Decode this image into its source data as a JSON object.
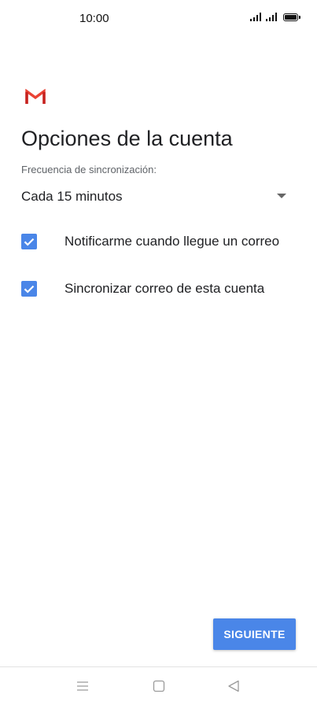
{
  "status_bar": {
    "time": "10:00"
  },
  "app": {
    "logo_icon": "gmail-logo-icon",
    "brand_colors": {
      "red": "#EA4335",
      "dark_red": "#C5221F"
    }
  },
  "page": {
    "title": "Opciones de la cuenta",
    "sync_frequency": {
      "label": "Frecuencia de sincronización:",
      "selected": "Cada 15 minutos"
    },
    "options": [
      {
        "label": "Notificarme cuando llegue un correo",
        "checked": true
      },
      {
        "label": "Sincronizar correo de esta cuenta",
        "checked": true
      }
    ]
  },
  "actions": {
    "next_label": "SIGUIENTE",
    "accent": "#4A86E8"
  },
  "nav_bar": {
    "buttons": [
      "menu-icon",
      "home-icon",
      "back-icon"
    ]
  }
}
